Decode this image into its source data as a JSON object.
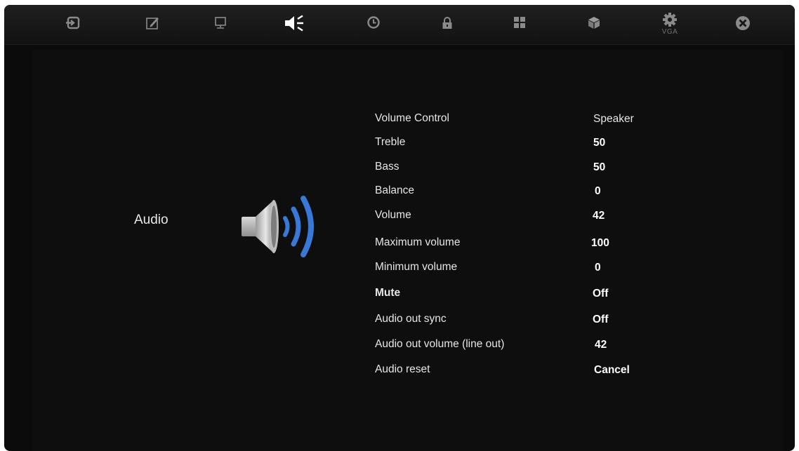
{
  "topbar": {
    "tabs": [
      {
        "icon": "input-icon",
        "caption": ""
      },
      {
        "icon": "edit-icon",
        "caption": ""
      },
      {
        "icon": "monitor-icon",
        "caption": ""
      },
      {
        "icon": "speaker-icon",
        "caption": "",
        "active": true
      },
      {
        "icon": "clock-icon",
        "caption": ""
      },
      {
        "icon": "lock-icon",
        "caption": ""
      },
      {
        "icon": "grid-icon",
        "caption": ""
      },
      {
        "icon": "cube-icon",
        "caption": ""
      },
      {
        "icon": "gear-icon",
        "caption": "VGA"
      },
      {
        "icon": "close-icon",
        "caption": ""
      }
    ]
  },
  "section": {
    "title": "Audio",
    "icon": "speaker-sound-icon",
    "accent_color": "#3a78d8"
  },
  "settings": [
    {
      "label": "Volume Control",
      "value": "Speaker"
    },
    {
      "label": "Treble",
      "value": "50"
    },
    {
      "label": "Bass",
      "value": "50"
    },
    {
      "label": "Balance",
      "value": "0"
    },
    {
      "label": "Volume",
      "value": "42"
    },
    {
      "label": "Maximum volume",
      "value": "100"
    },
    {
      "label": "Minimum volume",
      "value": "0"
    },
    {
      "label": "Mute",
      "value": "Off"
    },
    {
      "label": "Audio out sync",
      "value": "Off"
    },
    {
      "label": "Audio out volume (line out)",
      "value": "42"
    },
    {
      "label": "Audio reset",
      "value": "Cancel"
    }
  ]
}
